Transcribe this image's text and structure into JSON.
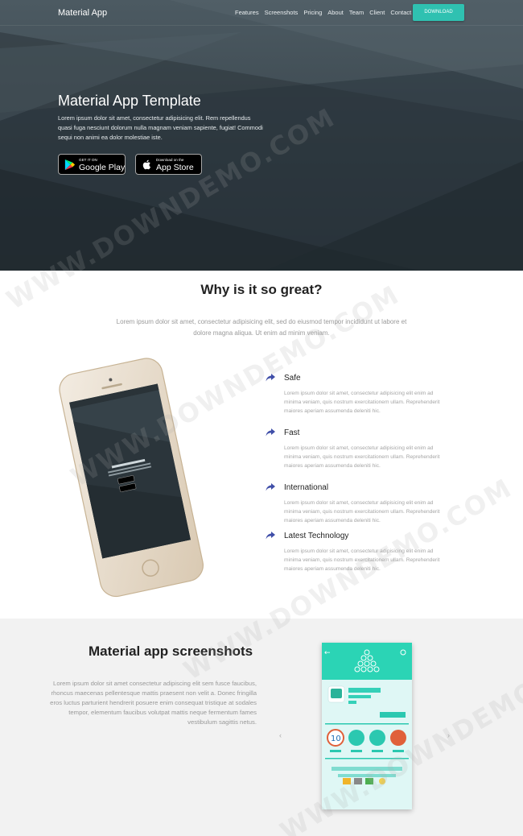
{
  "header": {
    "brand": "Material App",
    "nav": [
      "Features",
      "Screenshots",
      "Pricing",
      "About",
      "Team",
      "Client",
      "Contact"
    ],
    "download_label": "DOWNLOAD"
  },
  "hero": {
    "title": "Material App Template",
    "text": "Lorem ipsum dolor sit amet, consectetur adipisicing elit. Rem repellendus quasi fuga nesciunt dolorum nulla magnam veniam sapiente, fugiat! Commodi sequi non animi ea dolor molestiae iste.",
    "google_play": {
      "small": "GET IT ON",
      "big": "Google Play"
    },
    "app_store": {
      "small": "Download on the",
      "big": "App Store"
    }
  },
  "why": {
    "title": "Why is it so great?",
    "subtitle": "Lorem ipsum dolor sit amet, consectetur adipisicing elit, sed do eiusmod tempor incididunt ut labore et dolore magna aliqua. Ut enim ad minim veniam.",
    "features": [
      {
        "title": "Safe",
        "text": "Lorem ipsum dolor sit amet, consectetur adipisicing elit enim ad minima veniam, quis nostrum exercitationem ullam. Reprehenderit maiores aperiam assumenda deleniti hic."
      },
      {
        "title": "Fast",
        "text": "Lorem ipsum dolor sit amet, consectetur adipisicing elit enim ad minima veniam, quis nostrum exercitationem ullam. Reprehenderit maiores aperiam assumenda deleniti hic."
      },
      {
        "title": "International",
        "text": "Lorem ipsum dolor sit amet, consectetur adipisicing elit enim ad minima veniam, quis nostrum exercitationem ullam. Reprehenderit maiores aperiam assumenda deleniti hic."
      },
      {
        "title": "Latest Technology",
        "text": "Lorem ipsum dolor sit amet, consectetur adipisicing elit enim ad minima veniam, quis nostrum exercitationem ullam. Reprehenderit maiores aperiam assumenda deleniti hic."
      }
    ]
  },
  "screenshots": {
    "title": "Material app screenshots",
    "text": "Lorem ipsum dolor sit amet consectetur adipiscing elit sem fusce faucibus, rhoncus maecenas pellentesque mattis praesent non velit a. Donec fringilla eros luctus parturient hendrerit posuere enim consequat tristique at sodales tempor, elementum faucibus volutpat mattis neque fermentum fames vestibulum sagittis netus.",
    "prev_icon": "‹",
    "next_icon": "›"
  },
  "icons": {
    "feature_icon": "share-arrow-icon",
    "google_play_icon": "play-triangle-icon",
    "apple_icon": "apple-icon"
  },
  "colors": {
    "accent": "#2fc1b1",
    "hero_dark": "#3b474e",
    "feature_icon": "#3f4ea8"
  },
  "watermark": "WWW.DOWNDEMO.COM"
}
